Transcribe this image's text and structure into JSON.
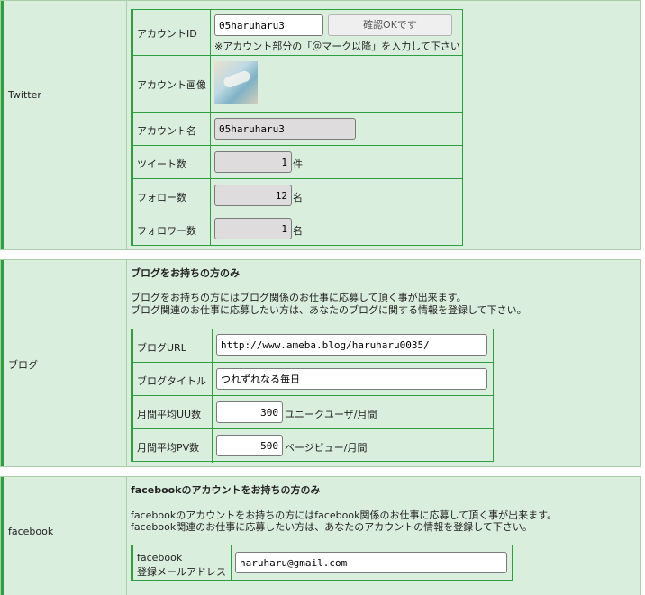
{
  "twitter": {
    "label": "Twitter",
    "rows": {
      "account_id": {
        "label": "アカウントID",
        "value": "05haruharu3",
        "confirm_button": "確認OKです",
        "note": "※アカウント部分の「＠マーク以降」を入力して下さい"
      },
      "image": {
        "label": "アカウント画像"
      },
      "name": {
        "label": "アカウント名",
        "value": "05haruharu3"
      },
      "tweets": {
        "label": "ツイート数",
        "value": "1",
        "unit": "件"
      },
      "follows": {
        "label": "フォロー数",
        "value": "12",
        "unit": "名"
      },
      "followers": {
        "label": "フォロワー数",
        "value": "1",
        "unit": "名"
      }
    }
  },
  "blog": {
    "label": "ブログ",
    "heading": "ブログをお持ちの方のみ",
    "desc1": "ブログをお持ちの方にはブログ関係のお仕事に応募して頂く事が出来ます。",
    "desc2": "ブログ関連のお仕事に応募したい方は、あなたのブログに関する情報を登録して下さい。",
    "rows": {
      "url": {
        "label": "ブログURL",
        "value": "http://www.ameba.blog/haruharu0035/"
      },
      "title": {
        "label": "ブログタイトル",
        "value": "つれずれなる毎日"
      },
      "uu": {
        "label": "月間平均UU数",
        "value": "300",
        "unit": "ユニークユーザ/月間"
      },
      "pv": {
        "label": "月間平均PV数",
        "value": "500",
        "unit": "ページビュー/月間"
      }
    }
  },
  "facebook": {
    "label": "facebook",
    "heading": "facebookのアカウントをお持ちの方のみ",
    "desc1": "facebookのアカウントをお持ちの方にはfacebook関係のお仕事に応募して頂く事が出来ます。",
    "desc2": "facebook関連のお仕事に応募したい方は、あなたのアカウントの情報を登録して下さい。",
    "rows": {
      "email": {
        "label_line1": "facebook",
        "label_line2": "登録メールアドレス",
        "value": "haruharu@gmail.com"
      }
    }
  },
  "colors": {
    "accent": "#2e9e3e",
    "section_bg": "#daeedd",
    "readonly_bg": "#dedcdc"
  },
  "icons": {
    "avatar": "account-avatar-image"
  }
}
